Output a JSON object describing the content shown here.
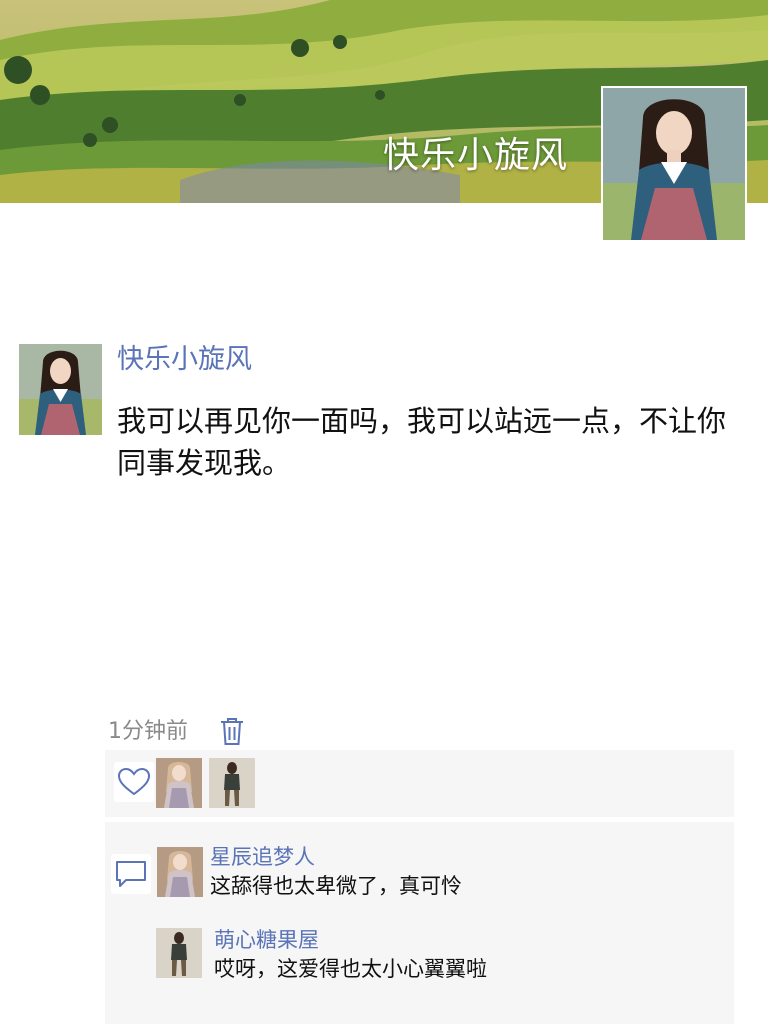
{
  "header": {
    "username": "快乐小旋风",
    "avatar_icon": "profile-photo-woman-hanbok"
  },
  "post": {
    "author": "快乐小旋风",
    "text": "我可以再见你一面吗，我可以站远一点，不让你同事发现我。",
    "time": "1分钟前"
  },
  "likes": {
    "icon": "heart-icon",
    "avatars": [
      "liker-avatar-1",
      "liker-avatar-2"
    ]
  },
  "comments": {
    "icon": "comment-icon",
    "items": [
      {
        "name": "星辰追梦人",
        "text": "这舔得也太卑微了，真可怜"
      },
      {
        "name": "萌心糖果屋",
        "text": "哎呀，这爱得也太小心翼翼啦"
      }
    ]
  },
  "colors": {
    "link_blue": "#5b74b8",
    "panel_bg": "#f6f6f6",
    "time_gray": "#8a8a8a"
  }
}
